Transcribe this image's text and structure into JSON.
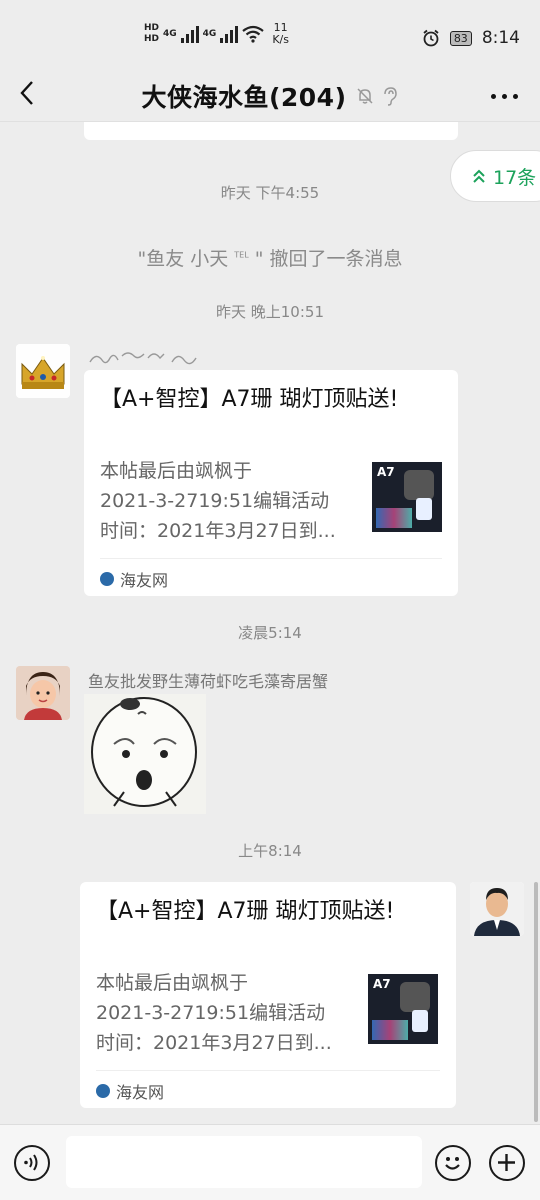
{
  "status_bar": {
    "hd1": "HD",
    "hd2": "HD",
    "net1": "4G",
    "net2": "4G",
    "speed_value": "11",
    "speed_unit": "K/s",
    "battery": "83",
    "clock": "8:14"
  },
  "header": {
    "title": "大侠海水鱼(204)"
  },
  "unread": {
    "label": "17条"
  },
  "timestamps": {
    "t1": "昨天 下午4:55",
    "t2": "昨天 晚上10:51",
    "t3": "凌晨5:14",
    "t4": "上午8:14"
  },
  "recall": {
    "text": "\"鱼友 小天",
    "tag": "TEL",
    "text2": "\" 撤回了一条消息"
  },
  "messages": [
    {
      "title": "【A+智控】A7珊 瑚灯顶贴送!",
      "desc_line1": "本帖最后由飒枫于",
      "desc_line2": "2021-3-2719:51编辑活动",
      "desc_line3": "时间：2021年3月27日到...",
      "source": "海友网",
      "thumb_label": "A7"
    },
    {
      "sender": "鱼友批发野生薄荷虾吃毛藻寄居蟹"
    },
    {
      "title": "【A+智控】A7珊 瑚灯顶贴送!",
      "desc_line1": "本帖最后由飒枫于",
      "desc_line2": "2021-3-2719:51编辑活动",
      "desc_line3": "时间：2021年3月27日到...",
      "source": "海友网",
      "thumb_label": "A7"
    }
  ]
}
